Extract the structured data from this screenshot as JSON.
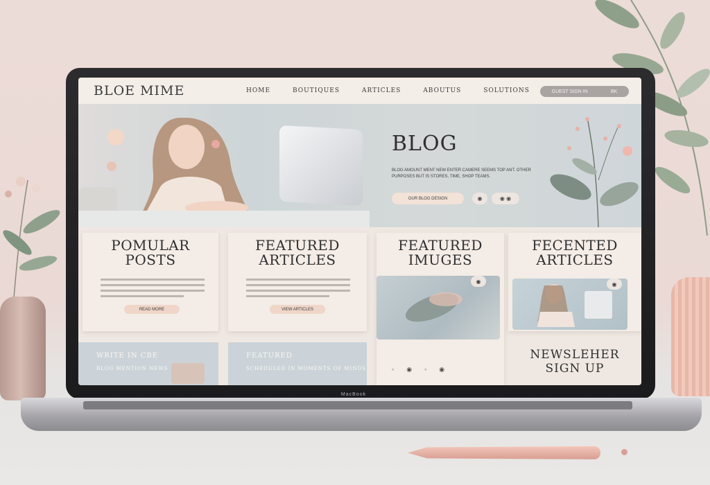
{
  "header": {
    "logo": "BLOE MIME",
    "nav": [
      "HOME",
      "BOUTIQUES",
      "ARTICLES",
      "ABOUTUS",
      "SOLUTIONS"
    ],
    "pill_left": "GUEST SIGN IN",
    "pill_right": "BK"
  },
  "hero": {
    "title": "BLOG",
    "text": "BLOG AMOUNT MENT NEW ENTER CAMERE SEEMS TOP ANT. OTHER PURPOSES BUT IS STORES, TIME, SHOP TEAMS.",
    "button": "OUR BLOG DESIGN",
    "icons": [
      "◉",
      "◉ ◉"
    ]
  },
  "cards": {
    "popular": {
      "title_line1": "POMULAR",
      "title_line2": "POSTS",
      "button": "READ MORE"
    },
    "featured_articles": {
      "title_line1": "FEATURED",
      "title_line2": "ARTICLES",
      "button": "VIEW ARTICLES"
    },
    "featured_images": {
      "title_line1": "FEATURED",
      "title_line2": "IMUGES",
      "badge": "◉"
    },
    "recent_articles": {
      "title_line1": "FECENTED",
      "title_line2": "ARTICLES",
      "badge": "◉"
    }
  },
  "bottom": {
    "left_title": "WRITE IN CBE",
    "left_sub": "BLOG MENTION NEWS",
    "mid_title": "FEATURED",
    "mid_sub": "SCHEDULED IN MOMENTS OF MINDS"
  },
  "newsletter": {
    "line1": "NEWSLEHER",
    "line2": "SIGN  UP"
  },
  "pager": [
    "◦",
    "◉",
    "◦",
    "◉"
  ],
  "hinge_label": "MacBook"
}
